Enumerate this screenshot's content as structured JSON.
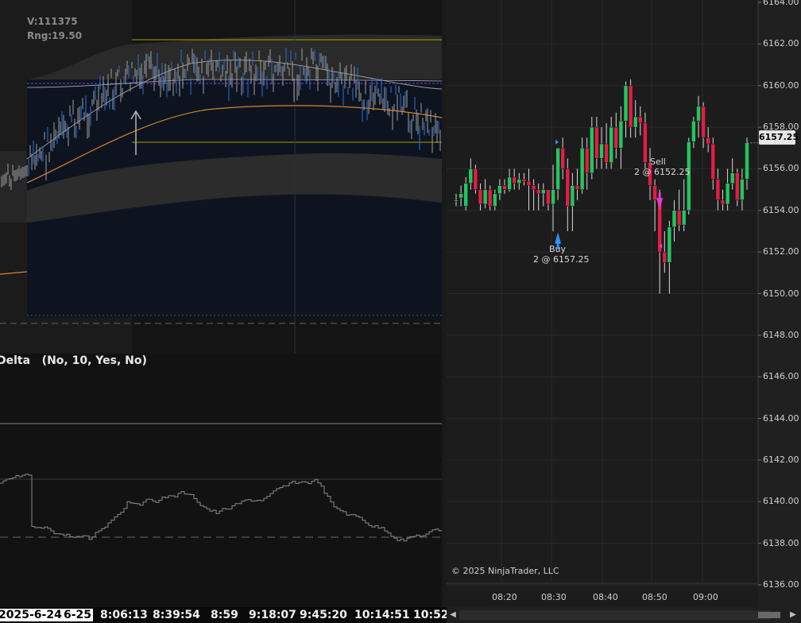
{
  "left_chart": {
    "volume_label": "V:111375",
    "range_label": "Rng:19.50",
    "indicator_label": "Delta   (No, 10, Yes, No)",
    "time_labels": [
      {
        "text": "2025-6-24",
        "highlight": true
      },
      {
        "text": "6-25",
        "highlight": true
      },
      {
        "text": "8:06:13",
        "highlight": false
      },
      {
        "text": "8:39:54",
        "highlight": false
      },
      {
        "text": "8:59",
        "highlight": false
      },
      {
        "text": "9:18:07",
        "highlight": false
      },
      {
        "text": "9:45:20",
        "highlight": false
      },
      {
        "text": "10:14:51",
        "highlight": false
      },
      {
        "text": "10:52",
        "highlight": false
      }
    ]
  },
  "right_chart": {
    "price_labels": [
      "6164.00",
      "6162.00",
      "6160.00",
      "6158.00",
      "6156.00",
      "6154.00",
      "6152.00",
      "6150.00",
      "6148.00",
      "6146.00",
      "6144.00",
      "6142.00",
      "6140.00",
      "6138.00",
      "6136.00"
    ],
    "current_price": "6157.25",
    "time_labels": [
      "08:20",
      "08:30",
      "08:40",
      "08:50",
      "09:00"
    ],
    "copyright": "© 2025 NinjaTrader, LLC",
    "buy": {
      "side": "Buy",
      "detail": "2 @ 6157.25"
    },
    "sell": {
      "side": "Sell",
      "detail": "2 @ 6152.25"
    },
    "colors": {
      "up": "#22c55e",
      "down": "#e11d48",
      "buy_arrow": "#2f8fff",
      "sell_arrow": "#e13cc8",
      "background": "#1c1c1c"
    }
  },
  "chart_data": {
    "type": "candlestick",
    "y_axis_range": [
      6135.5,
      6164.3
    ],
    "x_labels": [
      "08:20",
      "08:30",
      "08:40",
      "08:50",
      "09:00"
    ],
    "candles": [
      [
        6154.5,
        6154.8,
        6154.2,
        6154.5
      ],
      [
        6154.6,
        6155.2,
        6154.2,
        6154.8
      ],
      [
        6154.2,
        6155.6,
        6154.0,
        6155.3
      ],
      [
        6155.3,
        6156.5,
        6155.0,
        6156.0
      ],
      [
        6156.0,
        6156.2,
        6154.8,
        6155.0
      ],
      [
        6155.0,
        6155.3,
        6154.0,
        6154.3
      ],
      [
        6154.3,
        6155.5,
        6154.1,
        6155.0
      ],
      [
        6155.0,
        6155.2,
        6154.0,
        6154.2
      ],
      [
        6154.2,
        6155.0,
        6154.0,
        6154.8
      ],
      [
        6154.8,
        6155.5,
        6154.5,
        6155.2
      ],
      [
        6155.2,
        6155.5,
        6154.8,
        6155.0
      ],
      [
        6155.0,
        6156.0,
        6154.9,
        6155.6
      ],
      [
        6155.6,
        6156.0,
        6155.0,
        6155.3
      ],
      [
        6155.3,
        6155.8,
        6155.0,
        6155.5
      ],
      [
        6155.5,
        6155.8,
        6155.2,
        6155.4
      ],
      [
        6155.4,
        6156.0,
        6154.0,
        6155.2
      ],
      [
        6155.2,
        6155.5,
        6154.0,
        6155.0
      ],
      [
        6155.0,
        6155.3,
        6154.0,
        6154.8
      ],
      [
        6154.8,
        6155.3,
        6154.2,
        6155.0
      ],
      [
        6155.0,
        6155.0,
        6154.0,
        6154.3
      ],
      [
        6154.3,
        6156.2,
        6153.0,
        6155.0
      ],
      [
        6155.0,
        6156.5,
        6154.5,
        6157.0
      ],
      [
        6157.0,
        6157.5,
        6155.5,
        6156.0
      ],
      [
        6156.0,
        6156.5,
        6153.0,
        6154.2
      ],
      [
        6154.2,
        6155.8,
        6153.0,
        6155.2
      ],
      [
        6155.2,
        6156.0,
        6154.5,
        6155.0
      ],
      [
        6155.0,
        6157.5,
        6154.8,
        6157.0
      ],
      [
        6157.0,
        6157.5,
        6155.0,
        6155.8
      ],
      [
        6155.8,
        6158.5,
        6155.5,
        6158.0
      ],
      [
        6158.0,
        6158.5,
        6156.0,
        6156.5
      ],
      [
        6156.5,
        6158.0,
        6156.0,
        6157.2
      ],
      [
        6157.2,
        6158.2,
        6156.0,
        6156.3
      ],
      [
        6156.3,
        6158.5,
        6156.0,
        6158.0
      ],
      [
        6158.0,
        6158.7,
        6156.5,
        6157.0
      ],
      [
        6157.0,
        6159.0,
        6156.0,
        6158.3
      ],
      [
        6158.3,
        6160.2,
        6157.5,
        6160.0
      ],
      [
        6160.0,
        6160.3,
        6157.5,
        6158.0
      ],
      [
        6158.0,
        6159.3,
        6157.5,
        6158.5
      ],
      [
        6158.5,
        6159.0,
        6157.6,
        6158.2
      ],
      [
        6158.2,
        6158.7,
        6156.0,
        6156.3
      ],
      [
        6156.3,
        6157.0,
        6154.5,
        6155.2
      ],
      [
        6155.2,
        6155.5,
        6153.0,
        6154.5
      ],
      [
        6154.5,
        6155.0,
        6150.0,
        6152.0
      ],
      [
        6152.0,
        6153.0,
        6151.0,
        6151.5
      ],
      [
        6151.5,
        6153.5,
        6150.0,
        6153.2
      ],
      [
        6153.2,
        6154.5,
        6152.5,
        6154.0
      ],
      [
        6154.0,
        6155.0,
        6153.0,
        6153.3
      ],
      [
        6153.3,
        6155.5,
        6153.0,
        6154.0
      ],
      [
        6154.0,
        6157.5,
        6153.8,
        6157.3
      ],
      [
        6157.3,
        6158.5,
        6157.0,
        6158.3
      ],
      [
        6158.3,
        6159.5,
        6157.5,
        6159.0
      ],
      [
        6159.0,
        6159.2,
        6157.0,
        6157.5
      ],
      [
        6157.5,
        6158.0,
        6156.8,
        6157.2
      ],
      [
        6157.2,
        6157.5,
        6155.0,
        6155.5
      ],
      [
        6155.5,
        6156.0,
        6154.0,
        6154.5
      ],
      [
        6154.5,
        6155.0,
        6154.0,
        6154.3
      ],
      [
        6154.3,
        6156.0,
        6154.0,
        6155.3
      ],
      [
        6155.3,
        6156.5,
        6155.0,
        6155.8
      ],
      [
        6155.8,
        6156.0,
        6154.2,
        6154.5
      ],
      [
        6154.5,
        6156.0,
        6154.0,
        6155.5
      ],
      [
        6155.5,
        6157.5,
        6155.0,
        6157.25
      ]
    ],
    "annotations": [
      {
        "type": "buy",
        "label": "Buy",
        "detail": "2 @ 6157.25",
        "candle_index": 21
      },
      {
        "type": "sell",
        "label": "Sell",
        "detail": "2 @ 6152.25",
        "candle_index": 42
      }
    ]
  }
}
